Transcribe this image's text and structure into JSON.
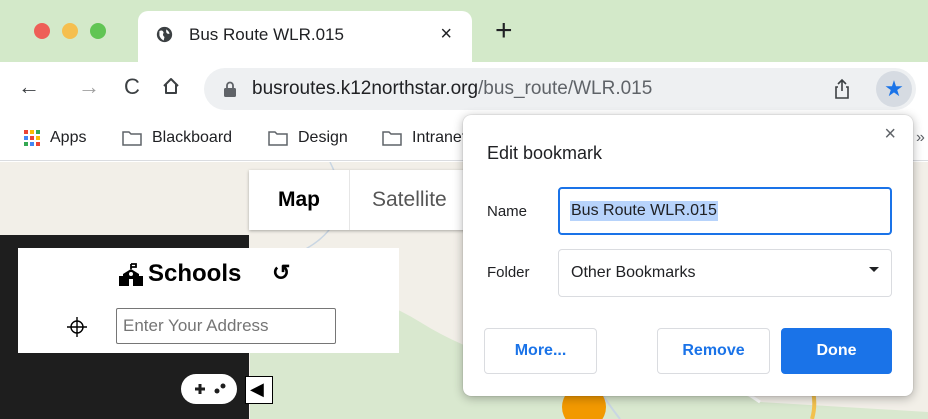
{
  "browser": {
    "tab": {
      "title": "Bus Route WLR.015",
      "close_glyph": "×"
    },
    "new_tab_glyph": "+",
    "nav": {
      "back_glyph": "←",
      "forward_glyph": "→",
      "reload_glyph": "C"
    },
    "url": {
      "host": "busroutes.k12northstar.org",
      "path": "/bus_route/WLR.015"
    },
    "star_glyph": "★",
    "bookmarks": [
      {
        "label": "Apps",
        "icon": "apps-grid-icon"
      },
      {
        "label": "Blackboard",
        "icon": "folder-icon"
      },
      {
        "label": "Design",
        "icon": "folder-icon"
      },
      {
        "label": "Intranet",
        "icon": "folder-icon"
      }
    ],
    "bookmarks_more_glyph": "»"
  },
  "page": {
    "map_types": {
      "map": "Map",
      "satellite": "Satellite"
    },
    "schools": {
      "title": "Schools",
      "refresh_glyph": "↺"
    },
    "address": {
      "placeholder": "Enter Your Address",
      "value": ""
    },
    "collapse_glyph": "◀"
  },
  "dialog": {
    "title": "Edit bookmark",
    "close_glyph": "×",
    "name_label": "Name",
    "name_value": "Bus Route WLR.015",
    "folder_label": "Folder",
    "folder_value": "Other Bookmarks",
    "more_label": "More...",
    "remove_label": "Remove",
    "done_label": "Done"
  },
  "colors": {
    "tabstrip": "#d3e9c9",
    "accent": "#1a73e8",
    "selection": "#b7d3fb",
    "panel_dark": "#1e1e1e"
  }
}
